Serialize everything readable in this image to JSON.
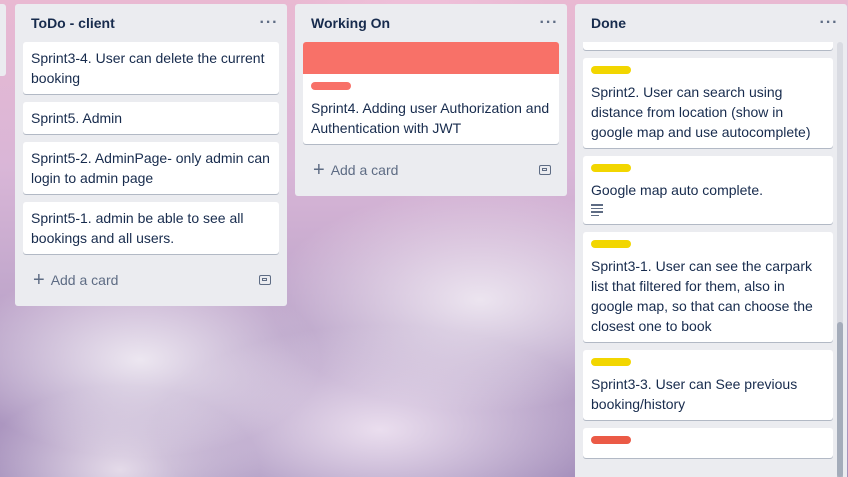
{
  "lists": [
    {
      "title": "ToDo - client",
      "menu": "···",
      "cards": [
        "Sprint3-4. User can delete the current booking",
        "Sprint5. Admin",
        "Sprint5-2. AdminPage- only admin can login to admin page",
        "Sprint5-1. admin be able to see all bookings and all users."
      ],
      "add_label": "Add a card"
    },
    {
      "title": "Working On",
      "menu": "···",
      "cards": [
        "Sprint4. Adding user Authorization and Authentication with JWT"
      ],
      "cover_color": "#f87168",
      "label_color": "#f87168",
      "add_label": "Add a card"
    },
    {
      "title": "Done",
      "menu": "···",
      "cards": [
        "Sprint2. User can search using distance from location (show in google map and use autocomplete)",
        "Google map auto complete.",
        "Sprint3-1. User can see the carpark list that filtered for them, also in google map, so that can choose the closest one to book",
        "Sprint3-3. User can See previous booking/history"
      ],
      "label_colors": [
        "#61bd4f",
        "#f2d600",
        "#f2d600",
        "#f2d600",
        "#f2d600",
        "#eb5a46"
      ]
    }
  ]
}
